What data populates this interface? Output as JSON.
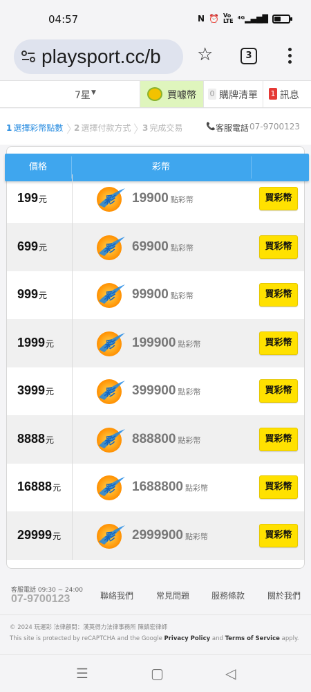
{
  "status_bar": {
    "time": "04:57",
    "battery_level": 0.45,
    "icons": [
      "nfc-icon",
      "alarm-icon",
      "volte-icon",
      "signal-icon",
      "battery-icon"
    ]
  },
  "browser": {
    "url": "playsport.cc/b",
    "tab_count": "3"
  },
  "site_nav": {
    "star_label": "7星",
    "buy_label": "買噱幣",
    "cart_count": "0",
    "cart_label": "購牌清單",
    "msg_count": "1",
    "msg_label": "訊息"
  },
  "steps": [
    {
      "num": "1",
      "label": "選擇彩幣點數",
      "active": true
    },
    {
      "num": "2",
      "label": "選擇付款方式",
      "active": false
    },
    {
      "num": "3",
      "label": "完成交易",
      "active": false
    }
  ],
  "service": {
    "label": "客服電話",
    "phone": "07-9700123"
  },
  "table": {
    "header_price": "價格",
    "header_coins": "彩幣",
    "price_unit": "元",
    "coin_unit": "點彩幣",
    "buy_label": "買彩幣",
    "rows": [
      {
        "price": "199",
        "coins": "19900"
      },
      {
        "price": "699",
        "coins": "69900"
      },
      {
        "price": "999",
        "coins": "99900"
      },
      {
        "price": "1999",
        "coins": "199900"
      },
      {
        "price": "3999",
        "coins": "399900"
      },
      {
        "price": "8888",
        "coins": "888800"
      },
      {
        "price": "16888",
        "coins": "1688800"
      },
      {
        "price": "29999",
        "coins": "2999900"
      }
    ]
  },
  "footer": {
    "hours": "客服電話 09:30 ~ 24:00",
    "phone": "07-9700123",
    "links": [
      "聯絡我們",
      "常見問題",
      "服務條款",
      "關於我們"
    ],
    "copyright": "© 2024 玩運彩 法律顧問：漢英得力法律事務所 陳鎮宏律師",
    "recaptcha_prefix": "This site is protected by reCAPTCHA and the Google ",
    "privacy": "Privacy Policy",
    "and": " and ",
    "terms": "Terms of Service",
    "suffix": " apply."
  },
  "colors": {
    "header_blue": "#3fa6ee",
    "buy_yellow": "#ffe100",
    "active_step": "#2a8de0",
    "buy_nav_bg": "#dff5bd"
  }
}
